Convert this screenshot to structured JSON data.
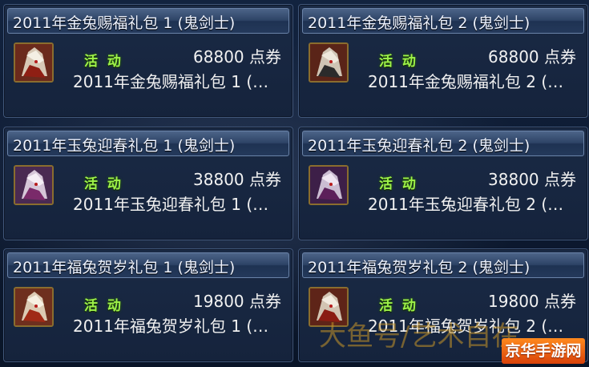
{
  "packages": [
    {
      "title": "2011年金兔赐福礼包 1 (鬼剑士)",
      "badge": "活 动",
      "price": "68800 点券",
      "description": "2011年金兔赐福礼包 1 (…"
    },
    {
      "title": "2011年金兔赐福礼包 2 (鬼剑士)",
      "badge": "活 动",
      "price": "68800 点券",
      "description": "2011年金兔赐福礼包 2 (…"
    },
    {
      "title": "2011年玉兔迎春礼包 1 (鬼剑士)",
      "badge": "活 动",
      "price": "38800 点券",
      "description": "2011年玉兔迎春礼包 1 (…"
    },
    {
      "title": "2011年玉兔迎春礼包 2 (鬼剑士)",
      "badge": "活 动",
      "price": "38800 点券",
      "description": "2011年玉兔迎春礼包 2 (…"
    },
    {
      "title": "2011年福兔贺岁礼包 1 (鬼剑士)",
      "badge": "活 动",
      "price": "19800 点券",
      "description": "2011年福兔贺岁礼包 1 (…"
    },
    {
      "title": "2011年福兔贺岁礼包 2 (鬼剑士)",
      "badge": "活 动",
      "price": "19800 点券",
      "description": "2011年福兔贺岁礼包 2 (…"
    }
  ],
  "colors": {
    "badge": "#9ef24a",
    "header_gradient_top": "#4c6488",
    "card_background": "#15233c",
    "icon_border": "#8a6d2e"
  },
  "watermark": "大鱼号/艺术自在",
  "corner_logo": "京华手游网",
  "icons": {
    "item_icon": "swordsman-portrait-icon"
  }
}
